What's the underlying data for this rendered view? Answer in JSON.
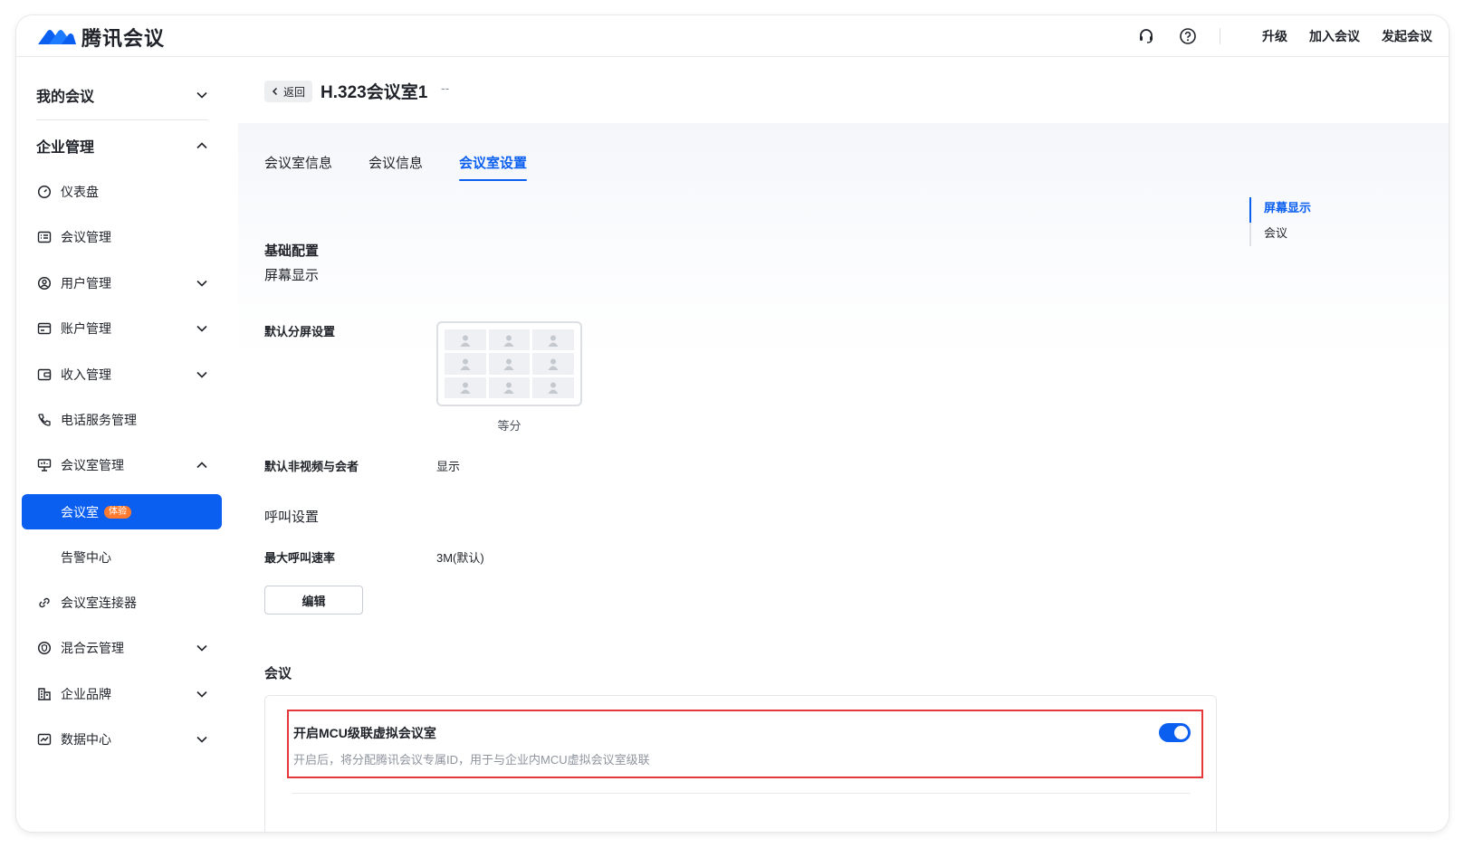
{
  "app": {
    "name": "腾讯会议",
    "accent_color": "#0a5ff0"
  },
  "topbar": {
    "icons": [
      "headset-icon",
      "help-icon"
    ],
    "links": [
      "升级",
      "加入会议",
      "发起会议"
    ]
  },
  "sidebar": {
    "groups": [
      {
        "label": "我的会议",
        "expanded": false
      },
      {
        "label": "企业管理",
        "expanded": true
      }
    ],
    "items": [
      {
        "label": "仪表盘",
        "icon": "dashboard-icon"
      },
      {
        "label": "会议管理",
        "icon": "list-icon"
      },
      {
        "label": "用户管理",
        "icon": "user-circle-icon"
      },
      {
        "label": "账户管理",
        "icon": "card-icon"
      },
      {
        "label": "收入管理",
        "icon": "wallet-icon"
      },
      {
        "label": "电话服务管理",
        "icon": "phone-icon"
      },
      {
        "label": "会议室管理",
        "icon": "room-icon"
      },
      {
        "label": "会议室",
        "badge": "体验",
        "active": true
      },
      {
        "label": "告警中心"
      },
      {
        "label": "会议室连接器",
        "icon": "link-icon"
      },
      {
        "label": "混合云管理",
        "icon": "shield-icon"
      },
      {
        "label": "企业品牌",
        "icon": "building-icon"
      },
      {
        "label": "数据中心",
        "icon": "chart-icon"
      }
    ]
  },
  "header": {
    "back_label": "返回",
    "title": "H.323会议室1",
    "title_suffix": "--"
  },
  "tabs": [
    "会议室信息",
    "会议信息",
    "会议室设置"
  ],
  "active_tab": "会议室设置",
  "anchors": [
    "屏幕显示",
    "会议"
  ],
  "settings": {
    "basic_title": "基础配置",
    "screen_sub": "屏幕显示",
    "default_split_label": "默认分屏设置",
    "default_split_value": "等分",
    "non_video_label": "默认非视频与会者",
    "non_video_value": "显示",
    "call_sub": "呼叫设置",
    "max_rate_label": "最大呼叫速率",
    "max_rate_value": "3M(默认)",
    "edit_label": "编辑"
  },
  "meeting": {
    "section_title": "会议",
    "option_title": "开启MCU级联虚拟会议室",
    "option_desc": "开启后，将分配腾讯会议专属ID，用于与企业内MCU虚拟会议室级联",
    "option_enabled": true
  }
}
